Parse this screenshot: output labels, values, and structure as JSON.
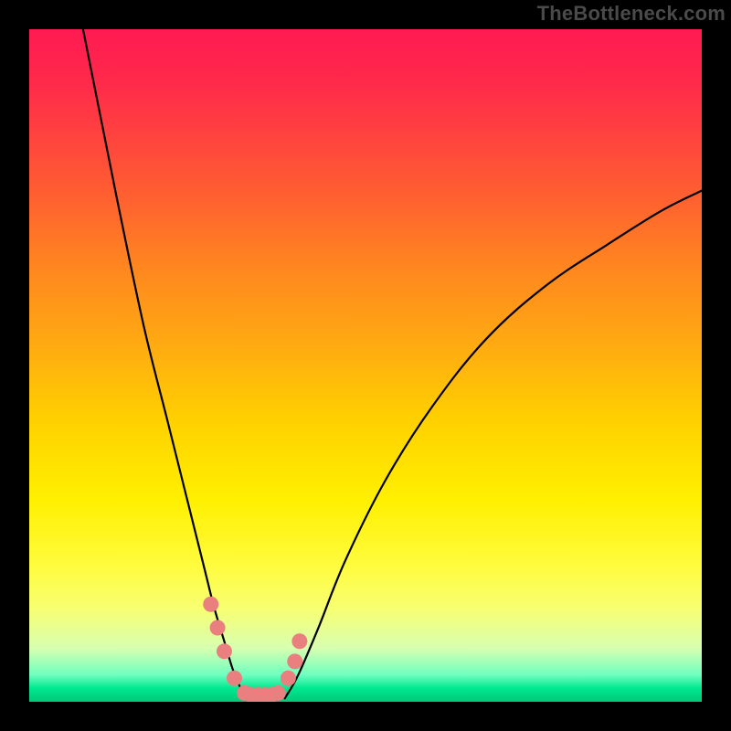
{
  "watermark": "TheBottleneck.com",
  "chart_data": {
    "type": "line",
    "title": "",
    "xlabel": "",
    "ylabel": "",
    "xlim": [
      0,
      100
    ],
    "ylim": [
      0,
      100
    ],
    "grid": false,
    "note": "Axis ranges are normalized to the plot area (0–100). Curve and marker coordinates are expressed in that space.",
    "series": [
      {
        "name": "left-branch",
        "x": [
          8,
          10,
          13,
          17,
          20.5,
          23.5,
          26,
          27.5,
          29,
          30.2,
          31.2,
          32
        ],
        "y": [
          100,
          90,
          75,
          56,
          42,
          30,
          20,
          14,
          9,
          5,
          2.5,
          0.5
        ]
      },
      {
        "name": "right-branch",
        "x": [
          38,
          40,
          43,
          47,
          53,
          60,
          68,
          77,
          86,
          94,
          100
        ],
        "y": [
          0.5,
          4,
          11,
          21,
          33,
          44,
          54,
          62,
          68,
          73,
          76
        ]
      }
    ],
    "markers": {
      "name": "range-markers",
      "x": [
        27.0,
        28.0,
        29.0,
        30.5,
        32.0,
        33.0,
        34.0,
        35.0,
        36.0,
        37.0,
        38.5,
        39.5,
        40.2
      ],
      "y": [
        14.5,
        11.0,
        7.5,
        3.5,
        1.3,
        1.0,
        1.0,
        1.0,
        1.0,
        1.3,
        3.5,
        6.0,
        9.0
      ]
    },
    "gradient_stops": [
      {
        "offset": 0,
        "color": "#ff1a52"
      },
      {
        "offset": 8,
        "color": "#ff2a4a"
      },
      {
        "offset": 15,
        "color": "#ff4040"
      },
      {
        "offset": 25,
        "color": "#ff6030"
      },
      {
        "offset": 35,
        "color": "#ff8520"
      },
      {
        "offset": 48,
        "color": "#ffae10"
      },
      {
        "offset": 58,
        "color": "#ffd000"
      },
      {
        "offset": 70,
        "color": "#fff000"
      },
      {
        "offset": 80,
        "color": "#fffc40"
      },
      {
        "offset": 86,
        "color": "#f8ff70"
      },
      {
        "offset": 92,
        "color": "#d8ffb0"
      },
      {
        "offset": 96,
        "color": "#70ffc0"
      },
      {
        "offset": 98,
        "color": "#00e890"
      },
      {
        "offset": 100,
        "color": "#00c878"
      }
    ]
  }
}
